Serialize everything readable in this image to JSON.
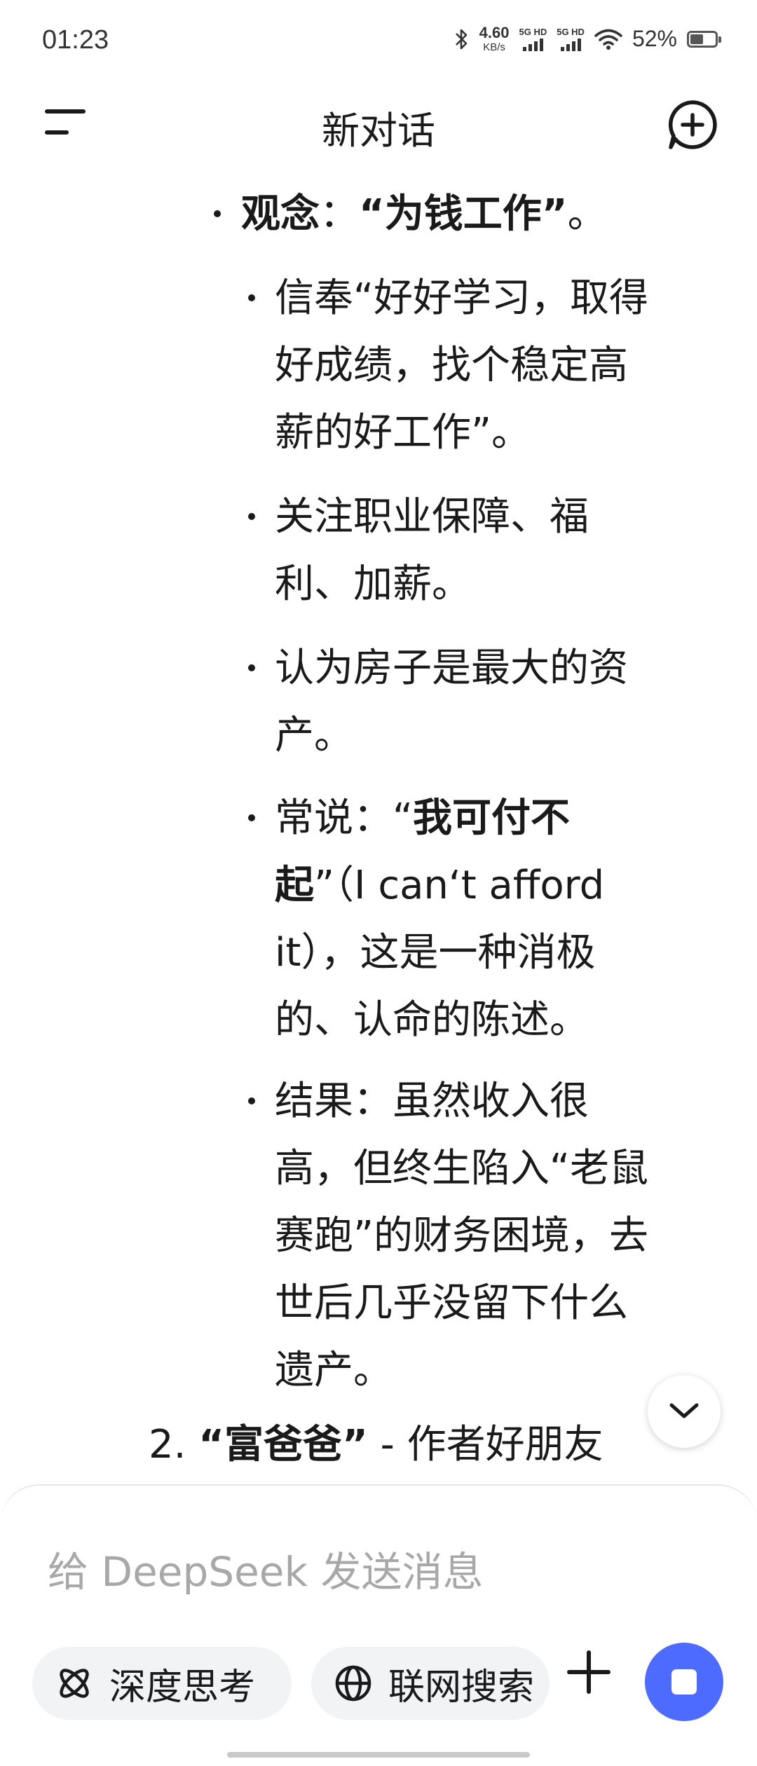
{
  "status_bar": {
    "time": "01:23",
    "net_speed_value": "4.60",
    "net_speed_unit": "KB/s",
    "sim1_label": "5G HD",
    "sim2_label": "5G HD",
    "battery_percent": "52%",
    "battery_level": 0.52
  },
  "header": {
    "title": "新对话"
  },
  "content": {
    "l1_item": {
      "bold_label": "观念",
      "sep": "：",
      "bold_value": "“为钱工作”",
      "end": "。"
    },
    "subitems": [
      {
        "lines": [
          "信奉“好好学习，取得",
          "好成绩，找个稳定高",
          "薪的好工作”。"
        ]
      },
      {
        "lines": [
          "关注职业保障、福",
          "利、加薪。"
        ]
      },
      {
        "lines": [
          "认为房子是最大的资",
          "产。"
        ]
      },
      {
        "prefix": "常说：“",
        "bold_part1": "我可付不",
        "bold_part2": "起",
        "suffix": "”（I can‘t afford",
        "line3": "it），这是一种消极",
        "line4": "的、认命的陈述。"
      },
      {
        "lines": [
          "结果：虽然收入很",
          "高，但终生陷入“老鼠",
          "赛跑”的财务困境，去",
          "世后几乎没留下什么",
          "遗产。"
        ]
      }
    ],
    "numbered_item": {
      "number": "2.",
      "bold": "“富爸爸”",
      "rest": " - 作者好朋友"
    }
  },
  "input": {
    "placeholder": "给 DeepSeek 发送消息",
    "deep_think_label": "深度思考",
    "web_search_label": "联网搜索"
  },
  "colors": {
    "accent": "#4d6bfe",
    "placeholder": "#a8a8a8",
    "pill_bg": "#f2f3f5"
  },
  "icons": {
    "menu": "menu-icon",
    "new_chat": "new-chat-icon",
    "scroll_down": "chevron-down-icon",
    "deep_think": "atom-icon",
    "web_search": "globe-icon",
    "attach": "plus-icon",
    "stop": "stop-icon"
  }
}
